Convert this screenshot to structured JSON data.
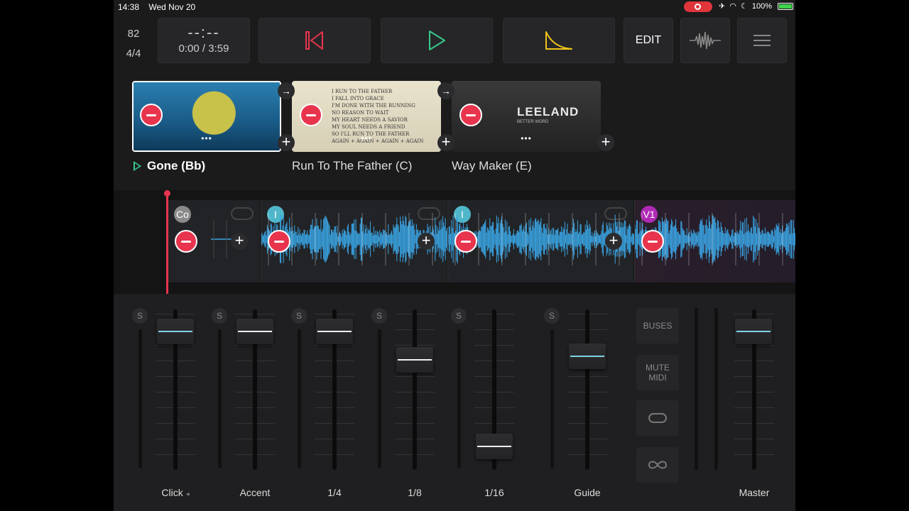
{
  "status": {
    "time": "14:38",
    "date": "Wed Nov 20",
    "battery": "100%"
  },
  "tempo": {
    "bpm": "82",
    "signature": "4/4"
  },
  "time_display": {
    "countdown": "--:--",
    "position": "0:00 / 3:59"
  },
  "toolbar": {
    "edit_label": "EDIT"
  },
  "colors": {
    "accent_red": "#e8344d",
    "play_green": "#37c98b",
    "prev_red": "#e8344d",
    "fade_yellow": "#f0c419",
    "waveform_blue": "#3aa6e6"
  },
  "setlist": [
    {
      "name": "Gone (Bb)",
      "active": true
    },
    {
      "name": "Run To The Father (C)",
      "active": false
    },
    {
      "name": "Way Maker (E)",
      "active": false
    }
  ],
  "artwork_text": {
    "song2_lyrics": "I RUN TO THE FATHER\nI FALL INTO GRACE\nI'M DONE WITH THE RUNNING\nNO REASON TO WAIT\nMY HEART NEEDS A SAVIOR\nMY SOUL NEEDS A FRIEND\nSO I'LL RUN TO THE FATHER\nAGAIN + AGAIN + AGAIN + AGAIN",
    "song3_artist": "LEELAND",
    "song3_album": "BETTER WORD"
  },
  "sections": [
    {
      "label": "Co",
      "color": "#8a8a8a"
    },
    {
      "label": "I",
      "color": "#4fb7c9"
    },
    {
      "label": "I",
      "color": "#4fb7c9"
    },
    {
      "label": "V1",
      "color": "#b02ab5"
    }
  ],
  "mixer": {
    "channels": [
      {
        "name": "Click",
        "level": 0.93,
        "blue": true,
        "has_arrow": true
      },
      {
        "name": "Accent",
        "level": 0.93,
        "blue": false
      },
      {
        "name": "1/4",
        "level": 0.93,
        "blue": false
      },
      {
        "name": "1/8",
        "level": 0.72,
        "blue": false
      },
      {
        "name": "1/16",
        "level": 0.08,
        "blue": false
      },
      {
        "name": "Guide",
        "level": 0.75,
        "blue": true
      }
    ],
    "solo_label": "S",
    "buses_label": "BUSES",
    "mute_midi_label": "MUTE MIDI",
    "master": {
      "name": "Master",
      "level": 0.93
    },
    "click_arrow": "◂"
  }
}
